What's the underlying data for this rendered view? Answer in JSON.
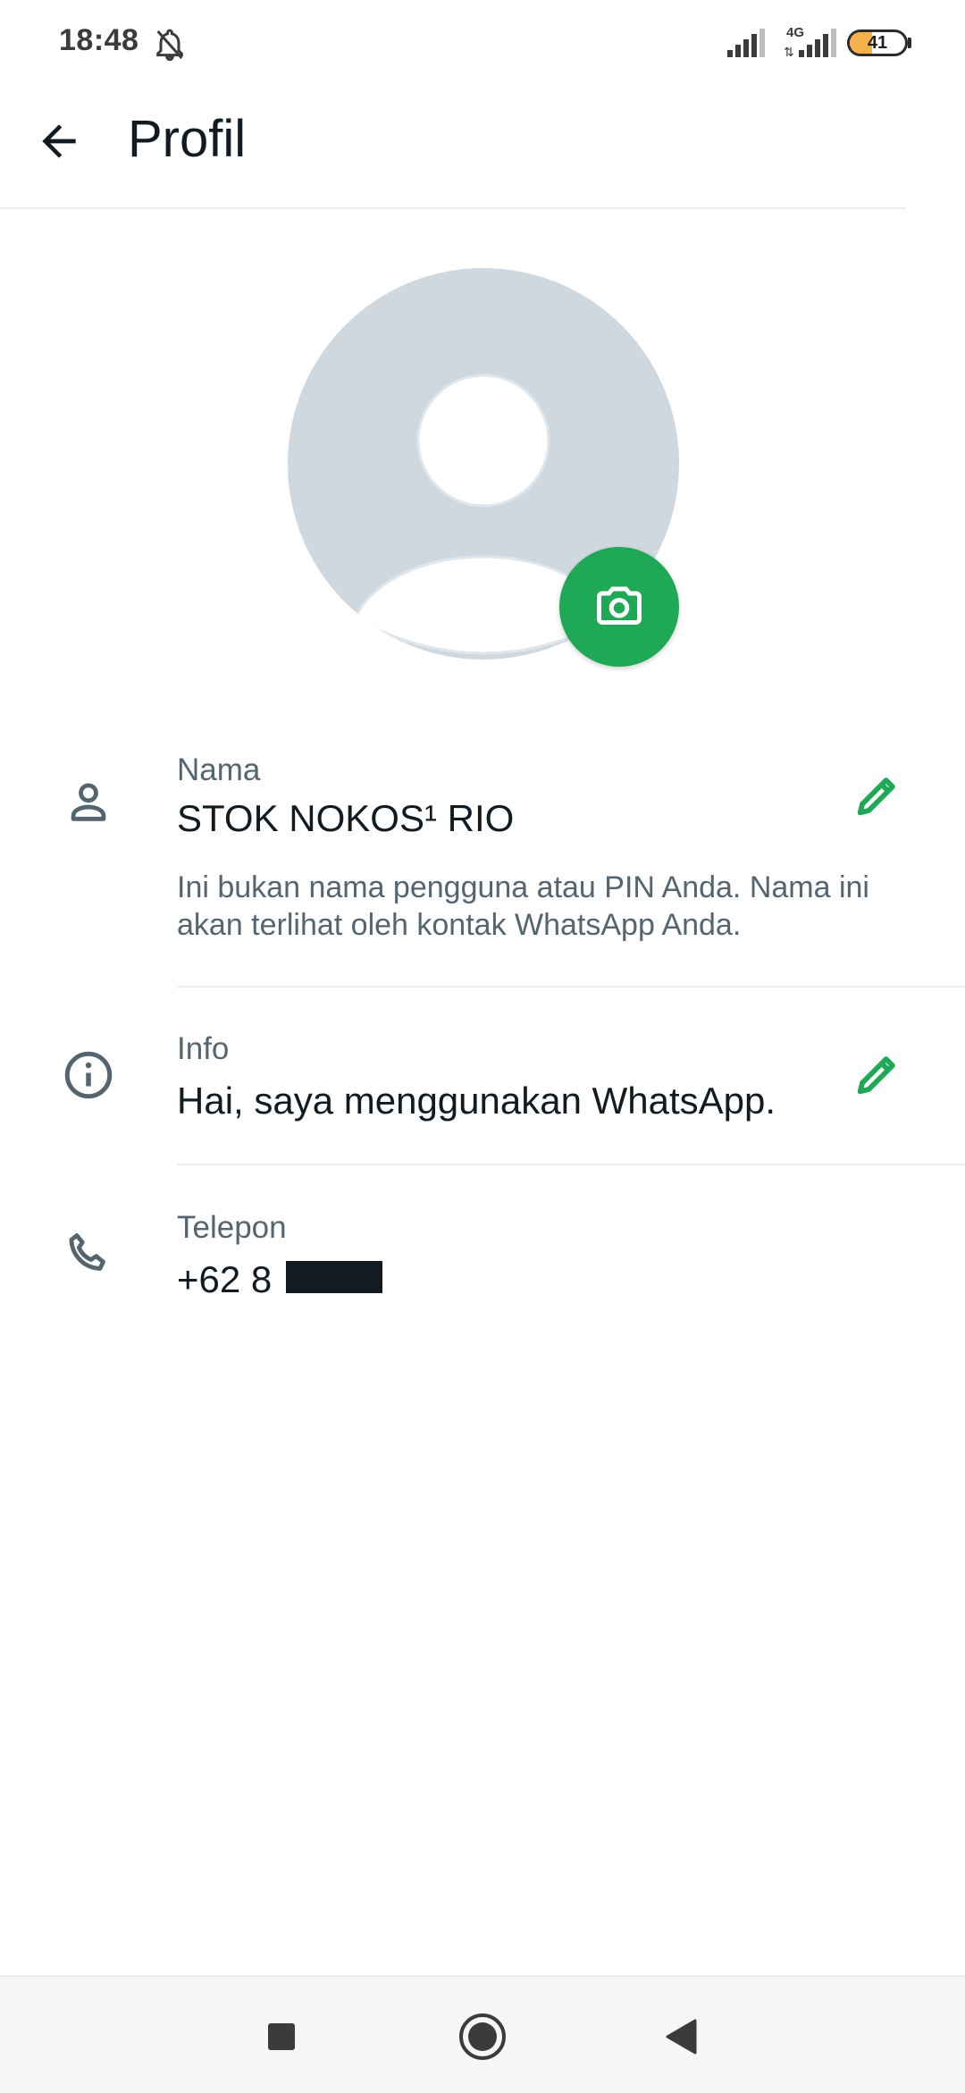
{
  "status_bar": {
    "time": "18:48",
    "network_type": "4G",
    "battery_level": "41",
    "icons": [
      "bell-off-icon",
      "signal-icon",
      "signal-icon",
      "battery-icon"
    ]
  },
  "app_bar": {
    "title": "Profil",
    "back_icon": "arrow-left-icon"
  },
  "avatar": {
    "placeholder_icon": "person-placeholder-icon",
    "camera_icon": "camera-icon",
    "accent_color": "#1fa855"
  },
  "name_row": {
    "label": "Nama",
    "value": "STOK NOKOS¹ RIO",
    "hint": "Ini bukan nama pengguna atau PIN Anda. Nama ini akan terlihat oleh kontak WhatsApp Anda.",
    "icon": "person-icon",
    "edit_icon": "pencil-icon"
  },
  "info_row": {
    "label": "Info",
    "value": "Hai, saya menggunakan WhatsApp.",
    "icon": "info-icon",
    "edit_icon": "pencil-icon"
  },
  "phone_row": {
    "label": "Telepon",
    "value": "+62 8",
    "icon": "phone-icon"
  },
  "nav_bar": {
    "icons": [
      "recents-square-icon",
      "home-circle-icon",
      "back-triangle-icon"
    ]
  }
}
